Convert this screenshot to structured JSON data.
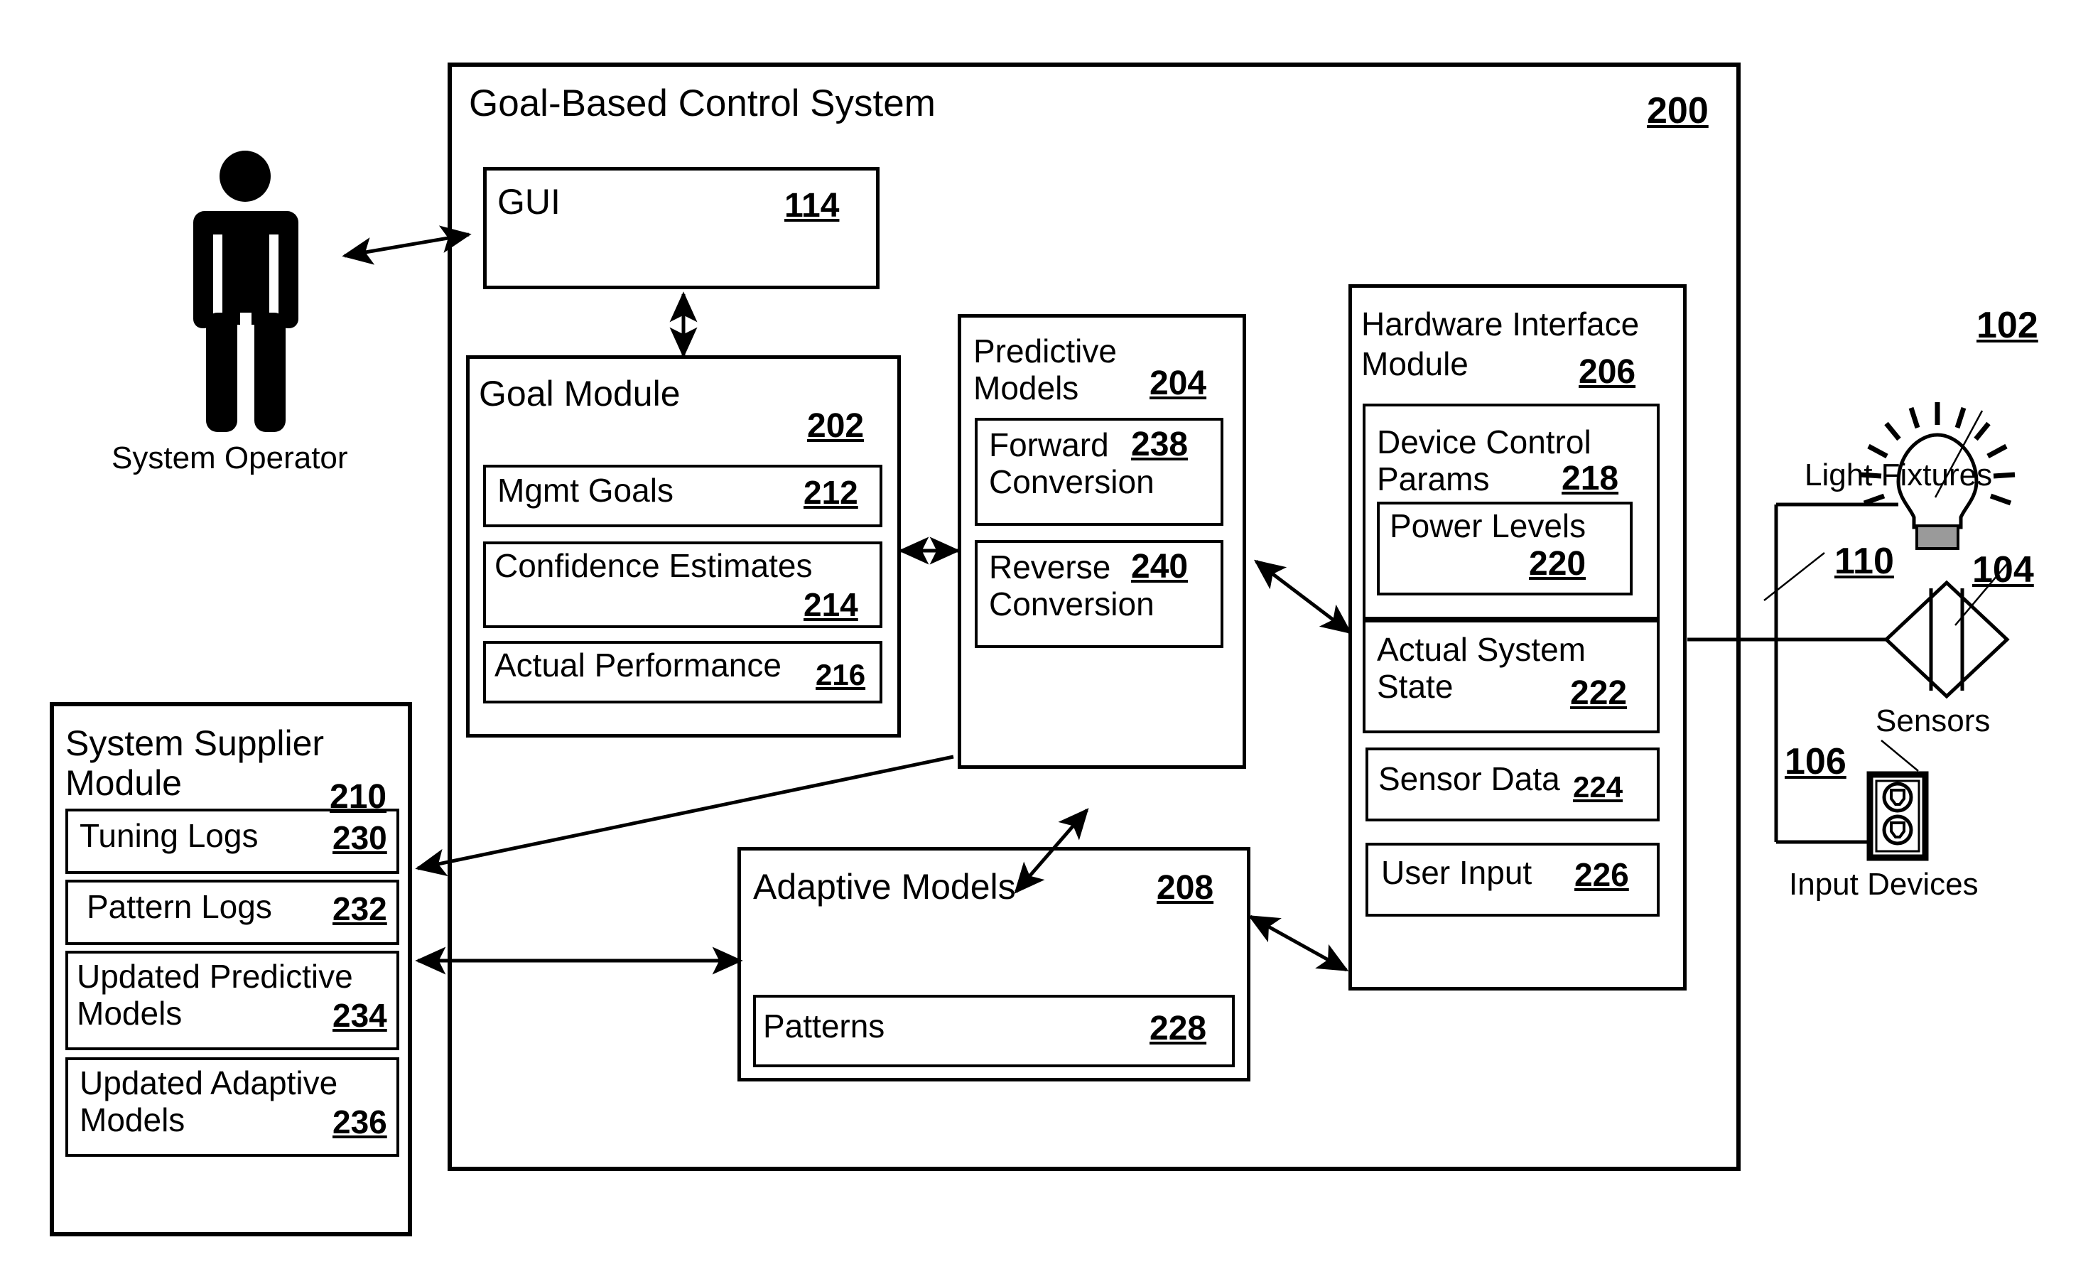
{
  "figure": {
    "title": "Goal-Based Control System",
    "system_ref": "200"
  },
  "operator": {
    "label": "System Operator",
    "icon": "person-icon"
  },
  "gui": {
    "label": "GUI",
    "ref": "114"
  },
  "goal_module": {
    "label": "Goal Module",
    "ref": "202",
    "items": [
      {
        "label": "Mgmt Goals",
        "ref": "212"
      },
      {
        "label": "Confidence Estimates",
        "ref": "214"
      },
      {
        "label": "Actual Performance",
        "ref": "216"
      }
    ]
  },
  "predictive_models": {
    "label_line1": "Predictive",
    "label_line2": "Models",
    "ref": "204",
    "items": [
      {
        "label_line1": "Forward",
        "label_line2": "Conversion",
        "ref": "238"
      },
      {
        "label_line1": "Reverse",
        "label_line2": "Conversion",
        "ref": "240"
      }
    ]
  },
  "hardware_interface_module": {
    "label_line1": "Hardware Interface",
    "label_line2": "Module",
    "ref": "206",
    "device_control_params": {
      "label_line1": "Device Control",
      "label_line2": "Params",
      "ref": "218",
      "power_levels": {
        "label": "Power Levels",
        "ref": "220"
      }
    },
    "items": [
      {
        "label_line1": "Actual System",
        "label_line2": "State",
        "ref": "222"
      },
      {
        "label_line1": "Sensor Data",
        "label_line2": "",
        "ref": "224"
      },
      {
        "label_line1": "User Input",
        "label_line2": "",
        "ref": "226"
      }
    ]
  },
  "adaptive_models": {
    "label": "Adaptive Models",
    "ref": "208",
    "patterns": {
      "label": "Patterns",
      "ref": "228"
    }
  },
  "system_supplier_module": {
    "label_line1": "System Supplier",
    "label_line2": "Module",
    "ref": "210",
    "items": [
      {
        "label_line1": "Tuning Logs",
        "label_line2": "",
        "ref": "230"
      },
      {
        "label_line1": "Pattern Logs",
        "label_line2": "",
        "ref": "232"
      },
      {
        "label_line1": "Updated Predictive",
        "label_line2": "Models",
        "ref": "234"
      },
      {
        "label_line1": "Updated Adaptive",
        "label_line2": "Models",
        "ref": "236"
      }
    ]
  },
  "devices": {
    "light_fixtures": {
      "label": "Light Fixtures",
      "ref": "102",
      "icon": "lightbulb-icon"
    },
    "sensors": {
      "label": "Sensors",
      "ref": "104",
      "icon": "sensor-diamond-icon"
    },
    "bus_ref": "110",
    "input_devices": {
      "label": "Input Devices",
      "ref": "106",
      "icon": "wall-outlet-icon"
    }
  }
}
